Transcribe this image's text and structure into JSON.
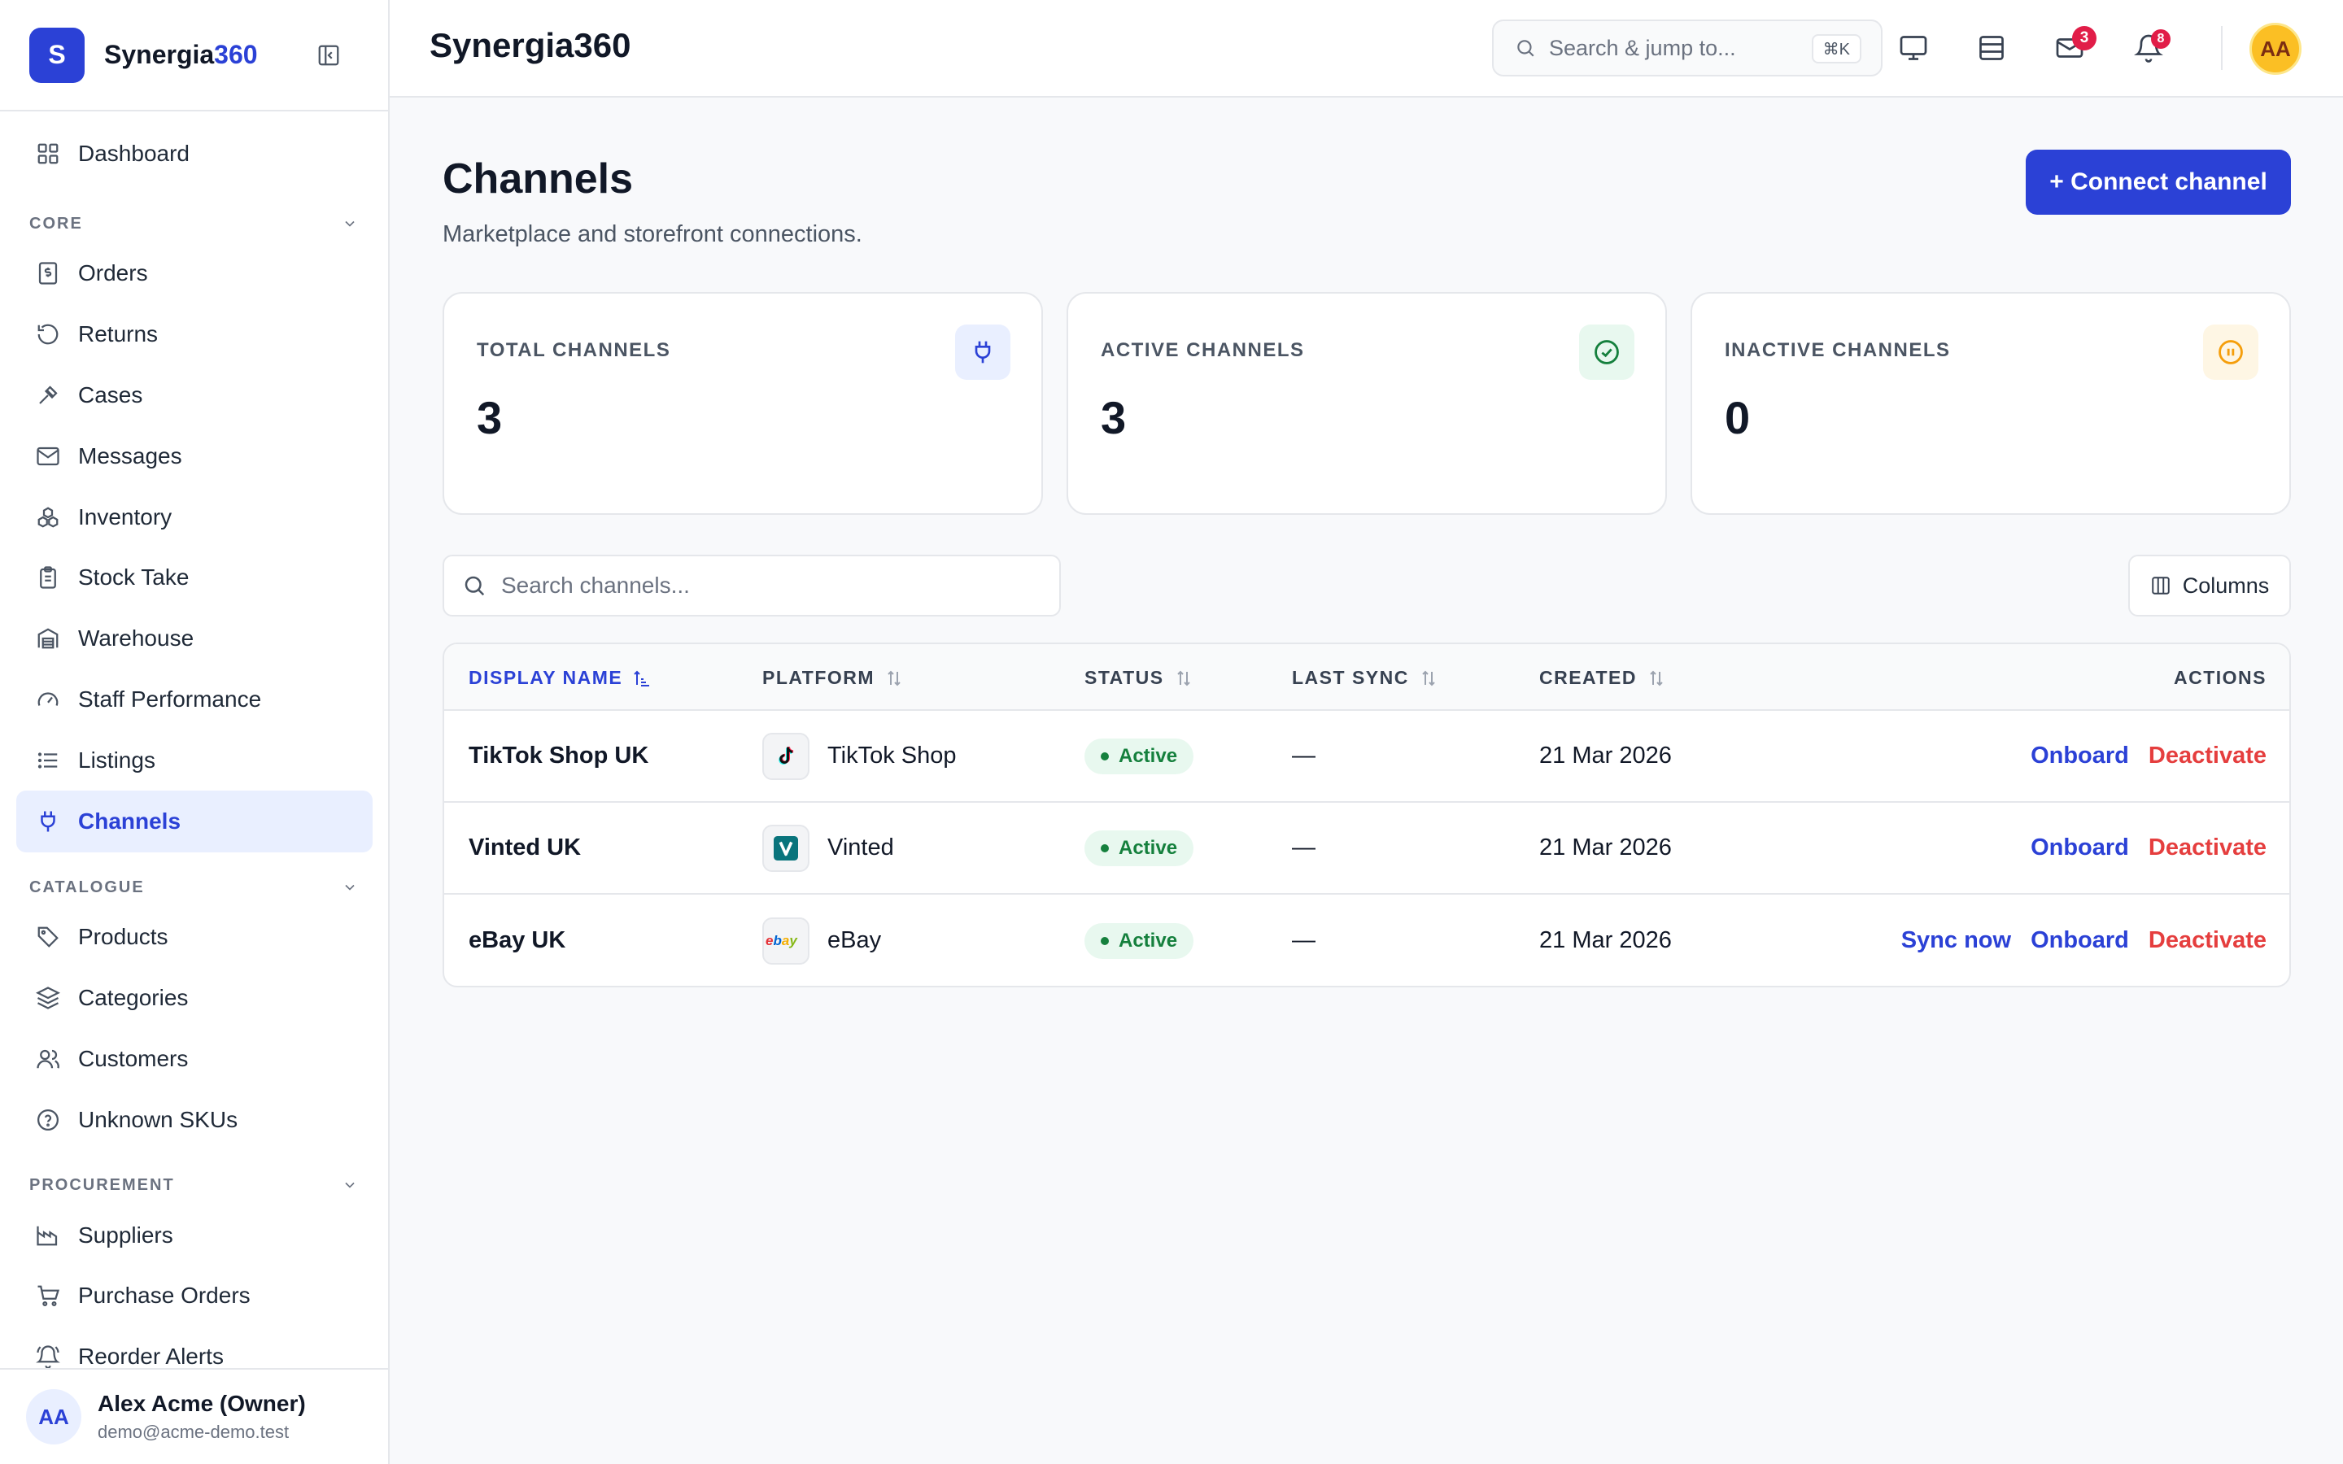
{
  "brand": {
    "initial": "S",
    "name_main": "Synergia",
    "name_accent": "360"
  },
  "topbar": {
    "title": "Synergia360",
    "search_placeholder": "Search & jump to...",
    "shortcut": "⌘K",
    "messages_badge": "3",
    "notifications_badge": "8",
    "avatar_initials": "AA"
  },
  "sidebar": {
    "dashboard": "Dashboard",
    "sections": {
      "core": "CORE",
      "catalogue": "CATALOGUE",
      "procurement": "PROCUREMENT"
    },
    "core_items": [
      "Orders",
      "Returns",
      "Cases",
      "Messages",
      "Inventory",
      "Stock Take",
      "Warehouse",
      "Staff Performance",
      "Listings",
      "Channels"
    ],
    "catalogue_items": [
      "Products",
      "Categories",
      "Customers",
      "Unknown SKUs"
    ],
    "procurement_items": [
      "Suppliers",
      "Purchase Orders",
      "Reorder Alerts"
    ],
    "active_item": "Channels"
  },
  "user": {
    "initials": "AA",
    "name": "Alex Acme (Owner)",
    "email": "demo@acme-demo.test"
  },
  "page": {
    "title": "Channels",
    "subtitle": "Marketplace and storefront connections.",
    "connect_button": "+ Connect channel"
  },
  "stats": [
    {
      "label": "TOTAL CHANNELS",
      "value": "3",
      "icon": "plug-icon",
      "color": "#2b41d6"
    },
    {
      "label": "ACTIVE CHANNELS",
      "value": "3",
      "icon": "check-circle-icon",
      "color": "#15803d"
    },
    {
      "label": "INACTIVE CHANNELS",
      "value": "0",
      "icon": "pause-circle-icon",
      "color": "#f59e0b"
    }
  ],
  "table": {
    "search_placeholder": "Search channels...",
    "columns_button": "Columns",
    "headers": [
      "DISPLAY NAME",
      "PLATFORM",
      "STATUS",
      "LAST SYNC",
      "CREATED",
      "ACTIONS"
    ],
    "rows": [
      {
        "display_name": "TikTok Shop UK",
        "platform": "TikTok Shop",
        "platform_icon": "tiktok-logo-icon",
        "status": "Active",
        "last_sync": "—",
        "created": "21 Mar 2026",
        "sync_now": "",
        "onboard": "Onboard",
        "deactivate": "Deactivate"
      },
      {
        "display_name": "Vinted UK",
        "platform": "Vinted",
        "platform_icon": "vinted-logo-icon",
        "status": "Active",
        "last_sync": "—",
        "created": "21 Mar 2026",
        "sync_now": "",
        "onboard": "Onboard",
        "deactivate": "Deactivate"
      },
      {
        "display_name": "eBay UK",
        "platform": "eBay",
        "platform_icon": "ebay-logo-icon",
        "status": "Active",
        "last_sync": "—",
        "created": "21 Mar 2026",
        "sync_now": "Sync now",
        "onboard": "Onboard",
        "deactivate": "Deactivate"
      }
    ]
  }
}
